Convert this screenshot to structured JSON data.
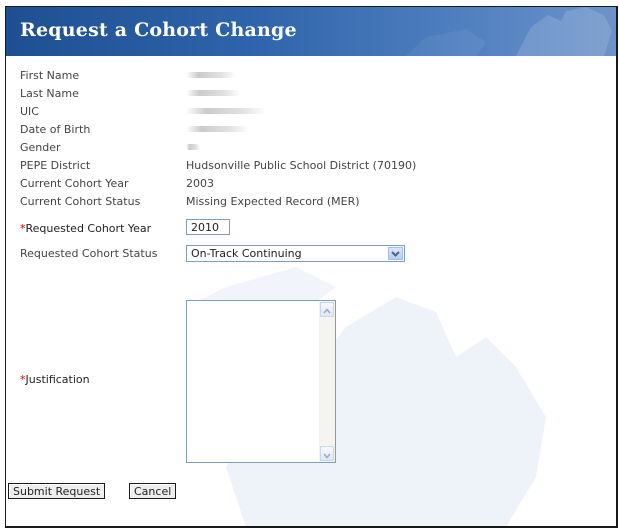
{
  "header": {
    "title": "Request a Cohort Change"
  },
  "fields": {
    "first_name": {
      "label": "First Name"
    },
    "last_name": {
      "label": "Last Name"
    },
    "uic": {
      "label": "UIC"
    },
    "dob": {
      "label": "Date of Birth"
    },
    "gender": {
      "label": "Gender"
    },
    "pepe_district": {
      "label": "PEPE District",
      "value": "Hudsonville Public School District (70190)"
    },
    "current_cohort_year": {
      "label": "Current Cohort Year",
      "value": "2003"
    },
    "current_cohort_status": {
      "label": "Current Cohort Status",
      "value": "Missing Expected Record (MER)"
    },
    "requested_cohort_year": {
      "required_mark": "*",
      "label": "Requested Cohort Year",
      "value": "2010"
    },
    "requested_cohort_status": {
      "label": "Requested Cohort Status",
      "value": "On-Track Continuing"
    },
    "justification": {
      "required_mark": "*",
      "label": "Justification",
      "value": ""
    }
  },
  "buttons": {
    "submit": "Submit Request",
    "cancel": "Cancel"
  },
  "colors": {
    "header_start": "#1e4f92",
    "header_end": "#6c93c9",
    "required": "#d40000"
  },
  "icons": [
    "chevron-down-icon",
    "scroll-up-arrow-icon",
    "scroll-down-arrow-icon",
    "michigan-map-watermark"
  ]
}
